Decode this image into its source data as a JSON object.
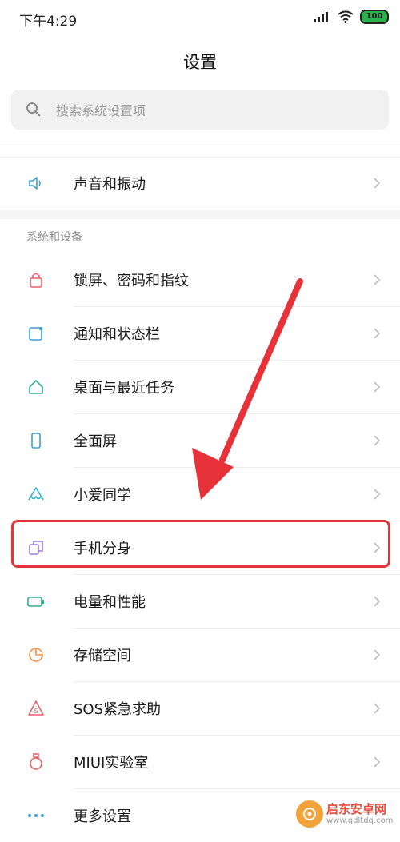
{
  "status_bar": {
    "time": "下午4:29",
    "battery": "100"
  },
  "header": {
    "title": "设置"
  },
  "search": {
    "placeholder": "搜索系统设置项"
  },
  "top_items": [
    {
      "label": "声音和振动",
      "icon": "speaker-icon"
    }
  ],
  "section": {
    "title": "系统和设备",
    "items": [
      {
        "label": "锁屏、密码和指纹",
        "icon": "lock-icon"
      },
      {
        "label": "通知和状态栏",
        "icon": "notification-icon"
      },
      {
        "label": "桌面与最近任务",
        "icon": "home-icon"
      },
      {
        "label": "全面屏",
        "icon": "fullscreen-icon"
      },
      {
        "label": "小爱同学",
        "icon": "xiaoai-icon"
      },
      {
        "label": "手机分身",
        "icon": "second-space-icon"
      },
      {
        "label": "电量和性能",
        "icon": "battery-icon"
      },
      {
        "label": "存储空间",
        "icon": "storage-icon"
      },
      {
        "label": "SOS紧急求助",
        "icon": "sos-icon"
      },
      {
        "label": "MIUI实验室",
        "icon": "lab-icon"
      },
      {
        "label": "更多设置",
        "icon": "more-icon"
      }
    ]
  },
  "colors": {
    "highlight": "#e8323a",
    "arrow": "#e8323a"
  },
  "watermark": {
    "name": "启东安卓网",
    "url": "www.qdltdq.com"
  }
}
